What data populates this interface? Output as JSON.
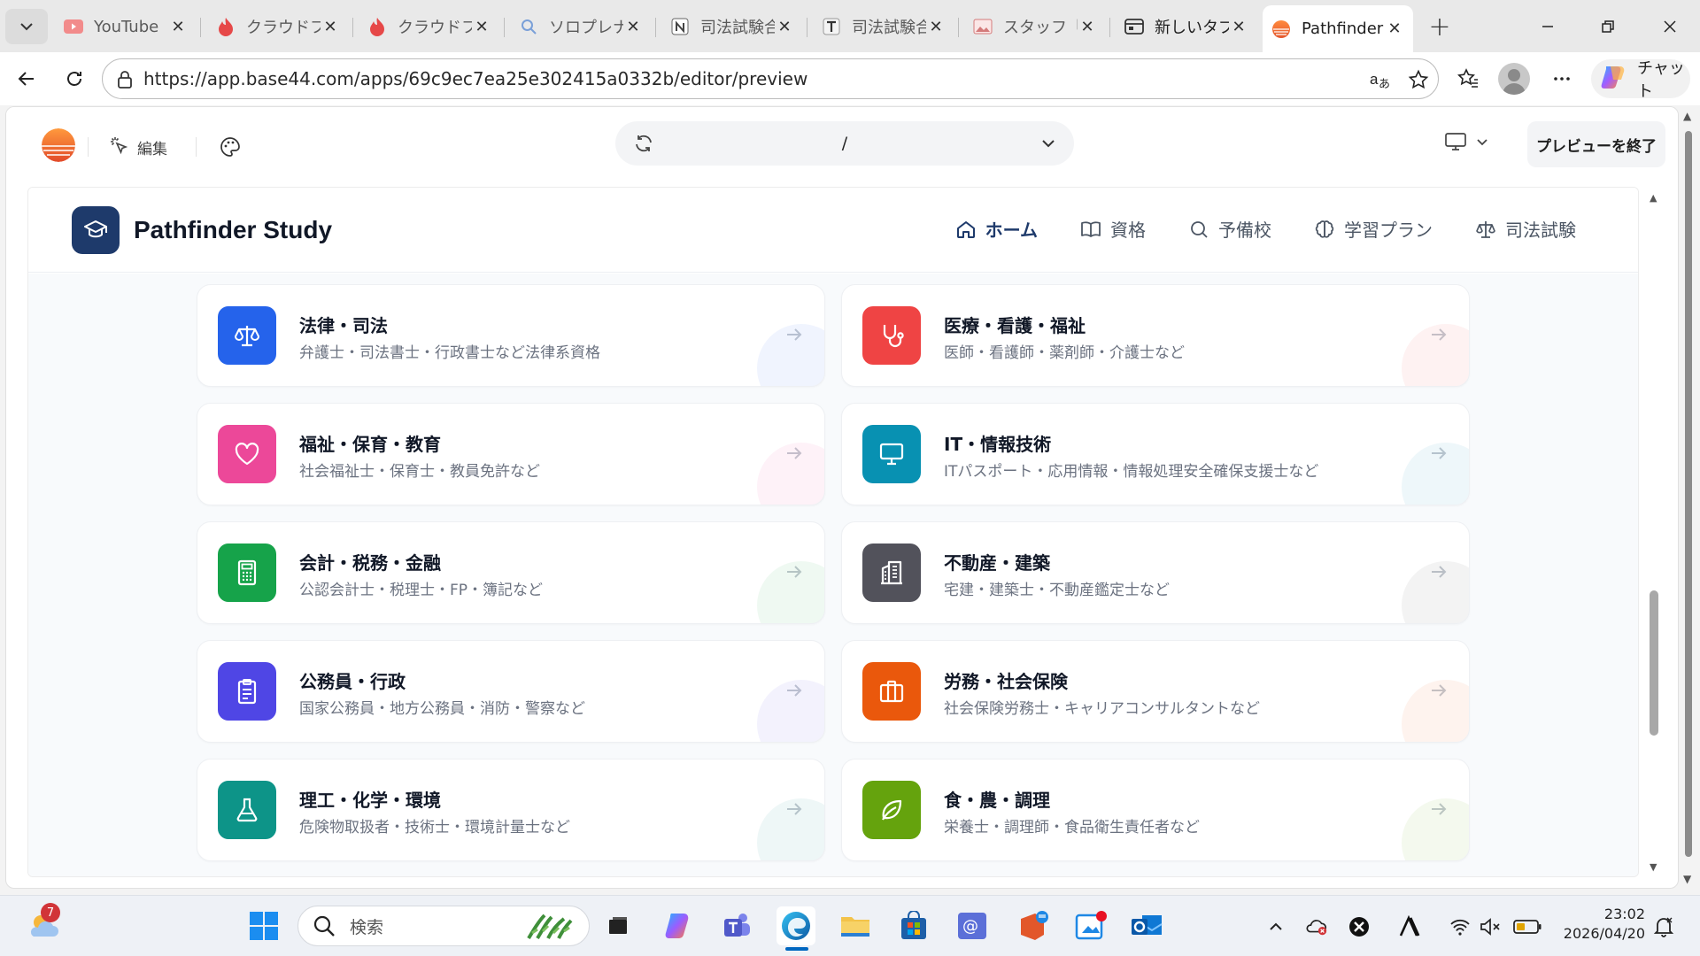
{
  "browser": {
    "tabs": [
      {
        "title": "YouTube",
        "icon": "youtube-icon",
        "active": false
      },
      {
        "title": "クラウドファン",
        "icon": "campfire-icon",
        "active": false
      },
      {
        "title": "クラウドファン",
        "icon": "campfire-icon",
        "active": false
      },
      {
        "title": "ソロプレナー",
        "icon": "search-icon",
        "active": false
      },
      {
        "title": "司法試験合",
        "icon": "notion-icon",
        "active": false
      },
      {
        "title": "司法試験合",
        "icon": "t-icon",
        "active": false
      },
      {
        "title": "スタッフ「町",
        "icon": "image-icon",
        "active": false
      },
      {
        "title": "新しいタブ",
        "icon": "newtab-icon",
        "active": false
      },
      {
        "title": "Pathfinder",
        "icon": "base44-icon",
        "active": true
      }
    ],
    "url": "https://app.base44.com/apps/69c9ec7ea25e302415a0332b/editor/preview",
    "copilot_label": "チャット"
  },
  "editor": {
    "edit_label": "編集",
    "path": "/",
    "exit_label": "プレビューを終了"
  },
  "site": {
    "brand": "Pathfinder Study",
    "nav": [
      {
        "label": "ホーム",
        "icon": "home-icon",
        "active": true
      },
      {
        "label": "資格",
        "icon": "book-icon",
        "active": false
      },
      {
        "label": "予備校",
        "icon": "search-icon",
        "active": false
      },
      {
        "label": "学習プラン",
        "icon": "brain-icon",
        "active": false
      },
      {
        "label": "司法試験",
        "icon": "scale-icon",
        "active": false
      }
    ],
    "categories": [
      {
        "title": "法律・司法",
        "sub": "弁護士・司法書士・行政書士など法律系資格",
        "icon": "scale-icon",
        "color": "#2563eb"
      },
      {
        "title": "医療・看護・福祉",
        "sub": "医師・看護師・薬剤師・介護士など",
        "icon": "stethoscope-icon",
        "color": "#ef4444"
      },
      {
        "title": "福祉・保育・教育",
        "sub": "社会福祉士・保育士・教員免許など",
        "icon": "heart-icon",
        "color": "#ec4899"
      },
      {
        "title": "IT・情報技術",
        "sub": "ITパスポート・応用情報・情報処理安全確保支援士など",
        "icon": "monitor-icon",
        "color": "#0891b2"
      },
      {
        "title": "会計・税務・金融",
        "sub": "公認会計士・税理士・FP・簿記など",
        "icon": "calculator-icon",
        "color": "#16a34a"
      },
      {
        "title": "不動産・建築",
        "sub": "宅建・建築士・不動産鑑定士など",
        "icon": "building-icon",
        "color": "#52525b"
      },
      {
        "title": "公務員・行政",
        "sub": "国家公務員・地方公務員・消防・警察など",
        "icon": "clipboard-icon",
        "color": "#4f46e5"
      },
      {
        "title": "労務・社会保険",
        "sub": "社会保険労務士・キャリアコンサルタントなど",
        "icon": "briefcase-icon",
        "color": "#ea580c"
      },
      {
        "title": "理工・化学・環境",
        "sub": "危険物取扱者・技術士・環境計量士など",
        "icon": "flask-icon",
        "color": "#0d9488"
      },
      {
        "title": "食・農・調理",
        "sub": "栄養士・調理師・食品衛生責任者など",
        "icon": "leaf-icon",
        "color": "#65a30d"
      }
    ]
  },
  "taskbar": {
    "weather_badge": "7",
    "search_placeholder": "検索",
    "time": "23:02",
    "date": "2026/04/20"
  }
}
